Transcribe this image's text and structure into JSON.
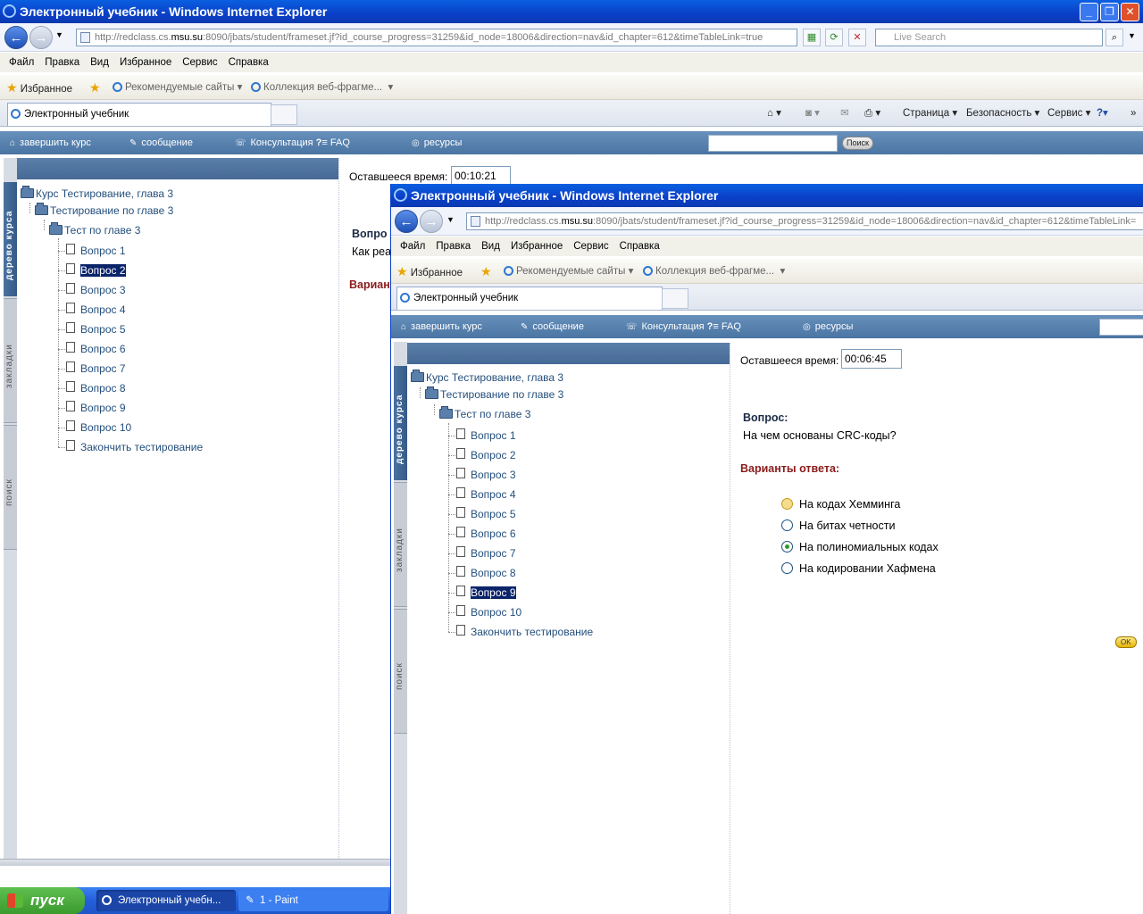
{
  "browser": {
    "title": "Электронный учебник - Windows Internet Explorer",
    "url_prefix": "http://redclass.cs.",
    "url_host": "msu.su",
    "url_rest": ":8090/jbats/student/frameset.jf?id_course_progress=31259&id_node=18006&direction=nav&id_chapter=612&timeTableLink=true",
    "url_rest_short": ":8090/jbats/student/frameset.jf?id_course_progress=31259&id_node=18006&direction=nav&id_chapter=612&timeTableLink=",
    "search_placeholder": "Live Search",
    "menu": [
      "Файл",
      "Правка",
      "Вид",
      "Избранное",
      "Сервис",
      "Справка"
    ],
    "favorites_label": "Избранное",
    "suggested_sites": "Рекомендуемые сайты",
    "web_slices": "Коллекция веб-фрагме...",
    "tab_label": "Электронный учебник",
    "commands": {
      "page": "Страница",
      "safety": "Безопасность",
      "tools": "Сервис"
    }
  },
  "app": {
    "end_course": "завершить курс",
    "message": "сообщение",
    "consultation": "Консультация",
    "faq": "FAQ",
    "resources": "ресурсы",
    "search_button": "Поиск",
    "side_tabs": [
      "дерево курса",
      "закладки",
      "поиск"
    ]
  },
  "tree": {
    "course": "Курс Тестирование, глава 3",
    "section": "Тестирование по главе 3",
    "test": "Тест по главе 3",
    "questions": [
      "Вопрос 1",
      "Вопрос 2",
      "Вопрос 3",
      "Вопрос 4",
      "Вопрос 5",
      "Вопрос 6",
      "Вопрос 7",
      "Вопрос 8",
      "Вопрос 9",
      "Вопрос 10"
    ],
    "finish": "Закончить тестирование"
  },
  "back_window": {
    "remaining_label": "Оставшееся время:",
    "remaining_value": "00:10:21",
    "question_label_partial": "Вопро",
    "question_text_partial": "Как реа",
    "variants_partial": "Вариан",
    "selected_question_index": 1
  },
  "front_window": {
    "remaining_label": "Оставшееся время:",
    "remaining_value": "00:06:45",
    "question_label": "Вопрос:",
    "question_text": "На чем основаны CRC-коды?",
    "variants_label": "Варианты ответа:",
    "options": [
      "На кодах Хемминга",
      "На битах четности",
      "На полиномиальных кодах",
      "На кодировании Хафмена"
    ],
    "checked_option_index": 2,
    "ok_button": "OK",
    "selected_question_index": 8
  },
  "taskbar": {
    "start": "пуск",
    "tasks": [
      "Электронный учебн...",
      "1 - Paint"
    ]
  }
}
